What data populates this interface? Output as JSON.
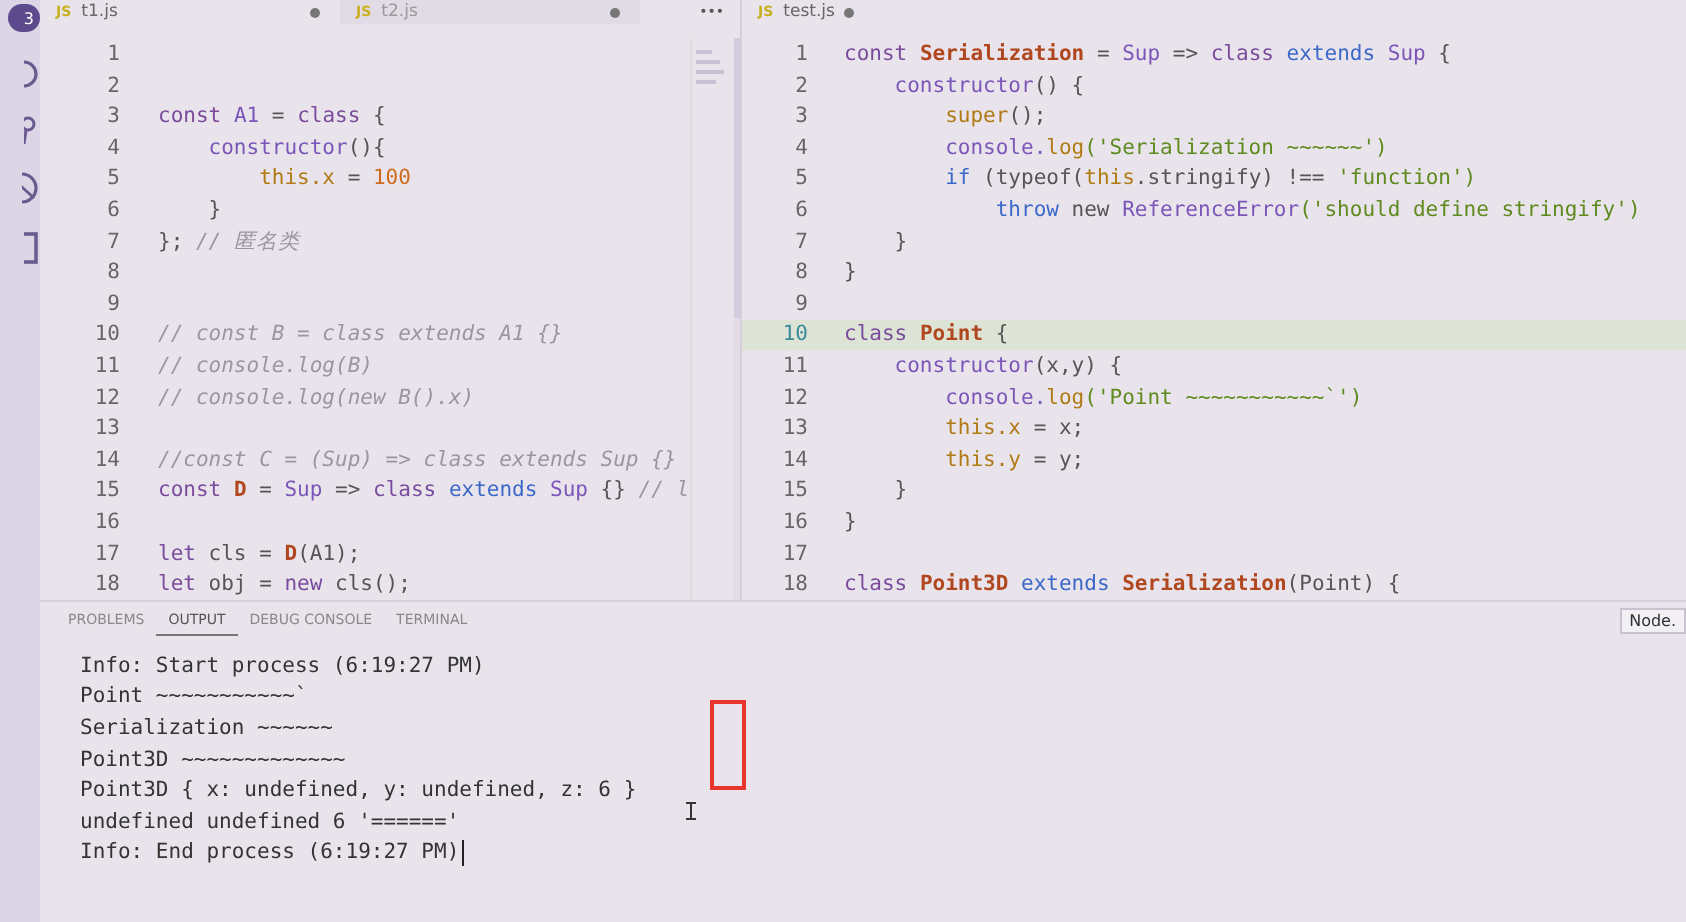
{
  "activity_bar": {
    "badge": "3"
  },
  "left_editor": {
    "tabs": [
      {
        "file_icon": "JS",
        "label": "t1.js",
        "selected": true,
        "modified": true
      },
      {
        "file_icon": "JS",
        "label": "t2.js",
        "selected": false,
        "modified": true
      }
    ],
    "more": "•••",
    "lines": [
      {
        "n": "1"
      },
      {
        "n": "2"
      },
      {
        "n": "3",
        "tokens": [
          {
            "kind": "kw",
            "text": "const "
          },
          {
            "kind": "ty",
            "text": "A1"
          },
          {
            "kind": "p",
            "text": " = "
          },
          {
            "kind": "kw",
            "text": "class"
          },
          {
            "kind": "p",
            "text": " {"
          }
        ]
      },
      {
        "n": "4",
        "tokens": [
          {
            "kind": "ty",
            "text": "    constructor"
          },
          {
            "kind": "p",
            "text": "(){"
          }
        ]
      },
      {
        "n": "5",
        "tokens": [
          {
            "kind": "th",
            "text": "        this.x"
          },
          {
            "kind": "p",
            "text": " = "
          },
          {
            "kind": "num",
            "text": "100"
          }
        ]
      },
      {
        "n": "6",
        "tokens": [
          {
            "kind": "p",
            "text": "    }"
          }
        ]
      },
      {
        "n": "7",
        "tokens": [
          {
            "kind": "p",
            "text": "}; "
          },
          {
            "kind": "cm",
            "text": "// 匿名类"
          }
        ]
      },
      {
        "n": "8"
      },
      {
        "n": "9"
      },
      {
        "n": "10",
        "tokens": [
          {
            "kind": "cm",
            "text": "// const B = class extends A1 {}"
          }
        ]
      },
      {
        "n": "11",
        "tokens": [
          {
            "kind": "cm",
            "text": "// console.log(B)"
          }
        ]
      },
      {
        "n": "12",
        "tokens": [
          {
            "kind": "cm",
            "text": "// console.log(new B().x)"
          }
        ]
      },
      {
        "n": "13"
      },
      {
        "n": "14",
        "tokens": [
          {
            "kind": "cm",
            "text": "//const C = (Sup) => class extends Sup {}"
          }
        ]
      },
      {
        "n": "15",
        "tokens": [
          {
            "kind": "kw",
            "text": "const "
          },
          {
            "kind": "name",
            "text": "D"
          },
          {
            "kind": "p",
            "text": " = "
          },
          {
            "kind": "ty",
            "text": "Sup"
          },
          {
            "kind": "p",
            "text": " => "
          },
          {
            "kind": "kw",
            "text": "class "
          },
          {
            "kind": "ext",
            "text": "extends "
          },
          {
            "kind": "ty",
            "text": "Sup"
          },
          {
            "kind": "p",
            "text": " {} "
          },
          {
            "kind": "cm",
            "text": "// l"
          }
        ]
      },
      {
        "n": "16"
      },
      {
        "n": "17",
        "tokens": [
          {
            "kind": "kw",
            "text": "let"
          },
          {
            "kind": "p",
            "text": " cls = "
          },
          {
            "kind": "name",
            "text": "D"
          },
          {
            "kind": "p",
            "text": "(A1);"
          }
        ]
      },
      {
        "n": "18",
        "tokens": [
          {
            "kind": "kw",
            "text": "let"
          },
          {
            "kind": "p",
            "text": " obj = "
          },
          {
            "kind": "kw",
            "text": "new"
          },
          {
            "kind": "p",
            "text": " cls();"
          }
        ]
      }
    ]
  },
  "right_editor": {
    "tabs": [
      {
        "file_icon": "JS",
        "label": "test.js",
        "selected": true,
        "modified": true
      }
    ],
    "lines": [
      {
        "n": "1",
        "current": false,
        "tokens": [
          {
            "kind": "kw",
            "text": "const "
          },
          {
            "kind": "name",
            "text": "Serialization"
          },
          {
            "kind": "p",
            "text": " = "
          },
          {
            "kind": "ty",
            "text": "Sup"
          },
          {
            "kind": "p",
            "text": " => "
          },
          {
            "kind": "kw",
            "text": "class "
          },
          {
            "kind": "ext",
            "text": "extends "
          },
          {
            "kind": "ty",
            "text": "Sup"
          },
          {
            "kind": "p",
            "text": " {"
          }
        ]
      },
      {
        "n": "2",
        "current": false,
        "tokens": [
          {
            "kind": "ty",
            "text": "    constructor"
          },
          {
            "kind": "p",
            "text": "() {"
          }
        ]
      },
      {
        "n": "3",
        "current": false,
        "tokens": [
          {
            "kind": "th",
            "text": "        super"
          },
          {
            "kind": "p",
            "text": "();"
          }
        ]
      },
      {
        "n": "4",
        "current": false,
        "tokens": [
          {
            "kind": "ty",
            "text": "        console."
          },
          {
            "kind": "th",
            "text": "log"
          },
          {
            "kind": "str",
            "text": "('Serialization ~~~~~~')"
          }
        ]
      },
      {
        "n": "5",
        "current": false,
        "tokens": [
          {
            "kind": "ext",
            "text": "        if"
          },
          {
            "kind": "p",
            "text": " (typeof("
          },
          {
            "kind": "th",
            "text": "this"
          },
          {
            "kind": "p",
            "text": ".stringify) !== "
          },
          {
            "kind": "str",
            "text": "'function')"
          }
        ]
      },
      {
        "n": "6",
        "current": false,
        "tokens": [
          {
            "kind": "ext",
            "text": "            throw"
          },
          {
            "kind": "p",
            "text": " new "
          },
          {
            "kind": "ty",
            "text": "ReferenceError"
          },
          {
            "kind": "str",
            "text": "('should define stringify')"
          }
        ]
      },
      {
        "n": "7",
        "current": false,
        "tokens": [
          {
            "kind": "p",
            "text": "    }"
          }
        ]
      },
      {
        "n": "8",
        "current": false,
        "tokens": [
          {
            "kind": "p",
            "text": "}"
          }
        ]
      },
      {
        "n": "9",
        "current": false
      },
      {
        "n": "10",
        "current": true,
        "tokens": [
          {
            "kind": "kw",
            "text": "class "
          },
          {
            "kind": "name",
            "text": "Point"
          },
          {
            "kind": "p",
            "text": " {"
          }
        ]
      },
      {
        "n": "11",
        "current": false,
        "tokens": [
          {
            "kind": "ty",
            "text": "    constructor"
          },
          {
            "kind": "p",
            "text": "(x,y) {"
          }
        ]
      },
      {
        "n": "12",
        "current": false,
        "tokens": [
          {
            "kind": "ty",
            "text": "        console."
          },
          {
            "kind": "th",
            "text": "log"
          },
          {
            "kind": "str",
            "text": "('Point ~~~~~~~~~~~`')"
          }
        ]
      },
      {
        "n": "13",
        "current": false,
        "tokens": [
          {
            "kind": "th",
            "text": "        this.x"
          },
          {
            "kind": "p",
            "text": " = x;"
          }
        ]
      },
      {
        "n": "14",
        "current": false,
        "tokens": [
          {
            "kind": "th",
            "text": "        this.y"
          },
          {
            "kind": "p",
            "text": " = y;"
          }
        ]
      },
      {
        "n": "15",
        "current": false,
        "tokens": [
          {
            "kind": "p",
            "text": "    }"
          }
        ]
      },
      {
        "n": "16",
        "current": false,
        "tokens": [
          {
            "kind": "p",
            "text": "}"
          }
        ]
      },
      {
        "n": "17",
        "current": false
      },
      {
        "n": "18",
        "current": false,
        "tokens": [
          {
            "kind": "kw",
            "text": "class "
          },
          {
            "kind": "name",
            "text": "Point3D"
          },
          {
            "kind": "ext",
            "text": " extends "
          },
          {
            "kind": "name",
            "text": "Serialization"
          },
          {
            "kind": "p",
            "text": "(Point) {"
          }
        ]
      }
    ]
  },
  "panel": {
    "tabs": [
      {
        "label": "PROBLEMS",
        "selected": false
      },
      {
        "label": "OUTPUT",
        "selected": true
      },
      {
        "label": "DEBUG CONSOLE",
        "selected": false
      },
      {
        "label": "TERMINAL",
        "selected": false
      }
    ],
    "channel_select": "Node.",
    "output": [
      "Info: Start process (6:19:27 PM)",
      "Point ~~~~~~~~~~~`",
      "Serialization ~~~~~~",
      "Point3D ~~~~~~~~~~~~~",
      "Point3D { x: undefined, y: undefined, z: 6 }",
      "undefined undefined 6 '======'",
      "Info: End process (6:19:27 PM)"
    ]
  }
}
